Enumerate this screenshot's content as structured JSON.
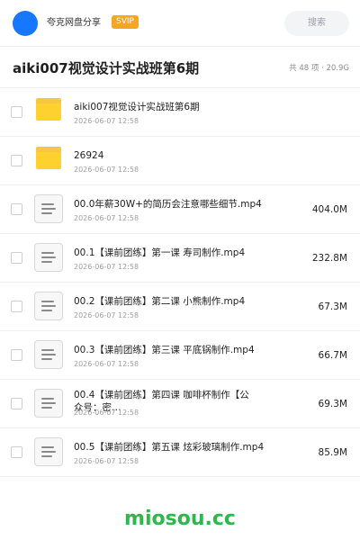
{
  "header": {
    "username": "夸克网盘分享",
    "badge": "SVIP",
    "search_placeholder": "搜索"
  },
  "folder": {
    "title": "aiki007视觉设计实战班第6期",
    "summary": "共 48 项 · 20.9G"
  },
  "files": [
    {
      "type": "folder",
      "name": "aiki007视觉设计实战班第6期",
      "date": "2026-06-07 12:58",
      "size": ""
    },
    {
      "type": "folder",
      "name": "26924",
      "date": "2026-06-07 12:58",
      "size": ""
    },
    {
      "type": "file",
      "name": "00.0年薪30W+的简历会注意哪些细节.mp4",
      "date": "2026-06-07 12:58",
      "size": "404.0M"
    },
    {
      "type": "file",
      "name": "00.1【课前团练】第一课 寿司制作.mp4",
      "date": "2026-06-07 12:58",
      "size": "232.8M"
    },
    {
      "type": "file",
      "name": "00.2【课前团练】第二课 小熊制作.mp4",
      "date": "2026-06-07 12:58",
      "size": "67.3M"
    },
    {
      "type": "file",
      "name": "00.3【课前团练】第三课 平底锅制作.mp4",
      "date": "2026-06-07 12:58",
      "size": "66.7M"
    },
    {
      "type": "file",
      "name": "00.4【课前团练】第四课 咖啡杯制作【公众号：密…",
      "date": "2026-06-07 12:58",
      "size": "69.3M"
    },
    {
      "type": "file",
      "name": "00.5【课前团练】第五课 炫彩玻璃制作.mp4",
      "date": "2026-06-07 12:58",
      "size": "85.9M"
    }
  ],
  "watermark": "miosou.cc",
  "colors": {
    "avatar": "#1677ff",
    "svip_badge": "#f5a623",
    "folder_icon": "#ffd12e",
    "watermark": "#2db84d"
  }
}
